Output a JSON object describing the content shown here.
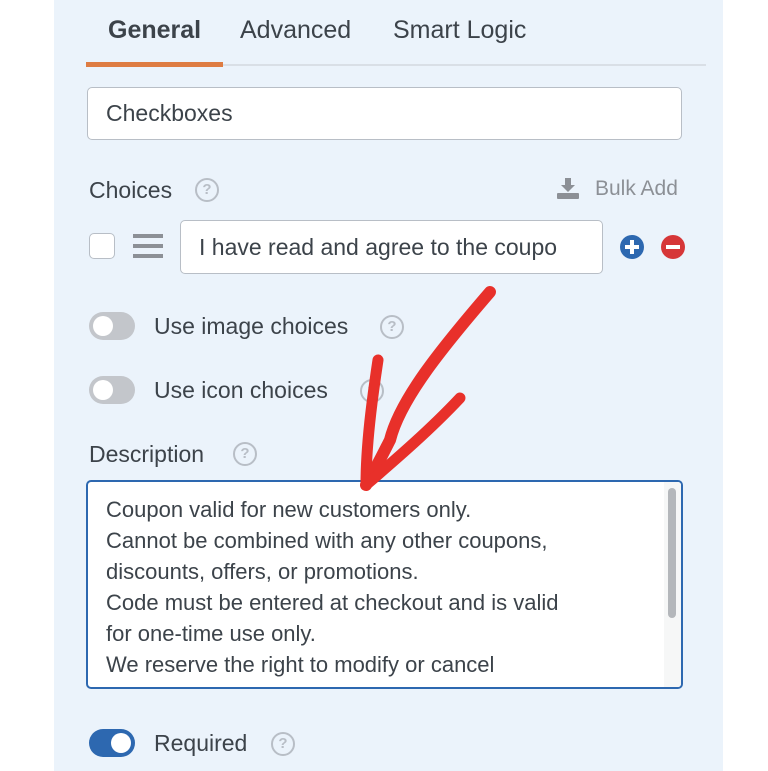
{
  "tabs": [
    {
      "label": "General",
      "active": true
    },
    {
      "label": "Advanced"
    },
    {
      "label": "Smart Logic"
    }
  ],
  "field_label_value": "Checkboxes",
  "choices": {
    "label": "Choices",
    "bulk_add": "Bulk Add",
    "items": [
      {
        "value": "I have read and agree to the coupo",
        "checked": false
      }
    ]
  },
  "toggles": {
    "image_choices": {
      "label": "Use image choices",
      "on": false
    },
    "icon_choices": {
      "label": "Use icon choices",
      "on": false
    },
    "required": {
      "label": "Required",
      "on": true
    }
  },
  "description": {
    "label": "Description",
    "value": "Coupon valid for new customers only.\nCannot be combined with any other coupons,\ndiscounts, offers, or promotions.\nCode must be entered at checkout and is valid\nfor one-time use only.\nWe reserve the right to modify or cancel"
  },
  "help_glyph": "?",
  "colors": {
    "accent_tab": "#de7c42",
    "toggle_on": "#2d68b0",
    "add": "#2d68b0",
    "remove": "#d63638",
    "annotation_arrow": "#e8302a"
  }
}
